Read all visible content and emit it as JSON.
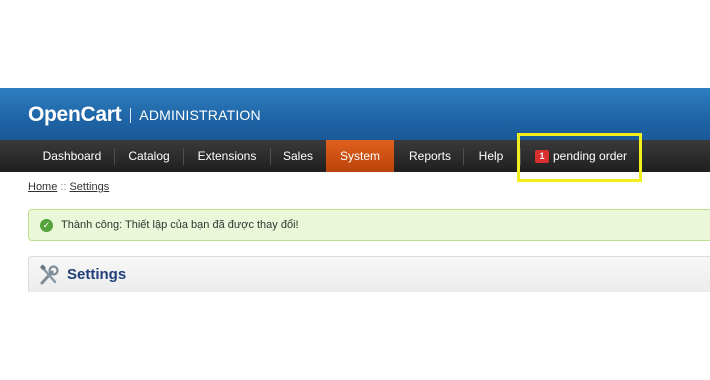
{
  "header": {
    "brand": "OpenCart",
    "subtitle": "ADMINISTRATION"
  },
  "menu": {
    "items": [
      {
        "label": "Dashboard"
      },
      {
        "label": "Catalog"
      },
      {
        "label": "Extensions"
      },
      {
        "label": "Sales"
      },
      {
        "label": "System",
        "active": true
      },
      {
        "label": "Reports"
      },
      {
        "label": "Help"
      }
    ],
    "pending": {
      "count": "1",
      "label": "pending order"
    }
  },
  "breadcrumb": {
    "home": "Home",
    "separator": "::",
    "current": "Settings"
  },
  "alert": {
    "message": "Thành công: Thiết lập của bạn đã được thay đổi!"
  },
  "panel": {
    "title": "Settings"
  },
  "colors": {
    "header_blue": "#1e64a6",
    "active_orange": "#d0521a",
    "highlight_yellow": "#f2ef1e",
    "badge_red": "#d9302f",
    "success_bg": "#eaf7d9"
  }
}
